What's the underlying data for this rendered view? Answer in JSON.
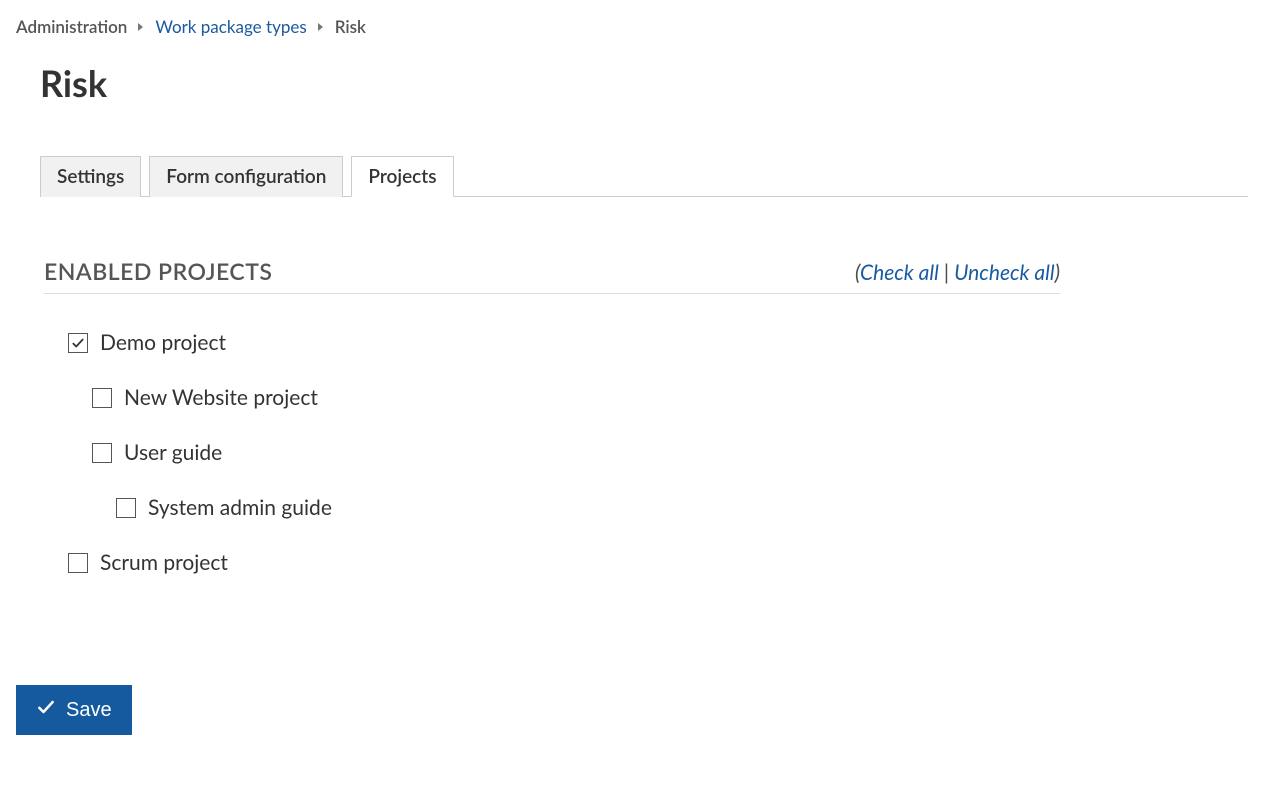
{
  "breadcrumb": {
    "administration": "Administration",
    "wp_types": "Work package types",
    "current": "Risk"
  },
  "header": {
    "title": "Risk"
  },
  "tabs": {
    "settings": "Settings",
    "form_config": "Form configuration",
    "projects": "Projects"
  },
  "section": {
    "title": "Enabled Projects",
    "check_all": "Check all",
    "uncheck_all": "Uncheck all"
  },
  "projects": [
    {
      "label": "Demo project",
      "checked": true,
      "indent": 0
    },
    {
      "label": "New Website project",
      "checked": false,
      "indent": 1
    },
    {
      "label": "User guide",
      "checked": false,
      "indent": 1
    },
    {
      "label": "System admin guide",
      "checked": false,
      "indent": 2
    },
    {
      "label": "Scrum project",
      "checked": false,
      "indent": 0
    }
  ],
  "actions": {
    "save": "Save"
  }
}
